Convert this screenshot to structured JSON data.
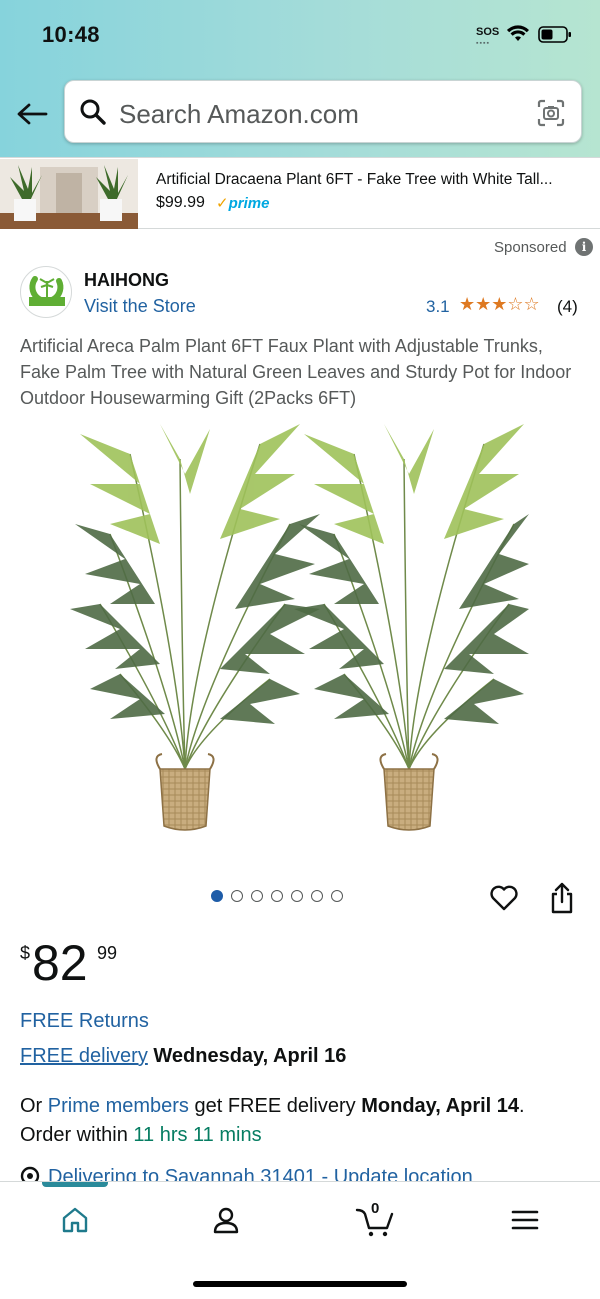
{
  "status_bar": {
    "time": "10:48",
    "sos": "SOS"
  },
  "header": {
    "search_placeholder": "Search Amazon.com",
    "back_icon": "back-arrow-icon",
    "search_icon": "search-icon",
    "camera_icon": "camera-icon"
  },
  "ad_banner": {
    "title": "Artificial Dracaena Plant 6FT - Fake Tree with White Tall...",
    "price": "$99.99",
    "prime_label": "prime"
  },
  "sponsored_label": "Sponsored",
  "brand": {
    "name": "HAIHONG",
    "visit_store": "Visit the Store",
    "logo_text": "HAIHONG"
  },
  "rating": {
    "value": "3.1",
    "stars": 3.1,
    "stars_text": "★★★☆☆",
    "count": "(4)"
  },
  "product": {
    "title": "Artificial Areca Palm Plant 6FT Faux Plant with Adjustable Trunks, Fake Palm Tree with Natural Green Leaves and Sturdy Pot for Indoor Outdoor Housewarming Gift (2Packs 6FT)",
    "image_count": 7,
    "active_image_index": 0
  },
  "price": {
    "symbol": "$",
    "whole": "82",
    "fraction": "99"
  },
  "shipping": {
    "free_returns": "FREE Returns",
    "free_delivery": "FREE delivery",
    "delivery_date": "Wednesday, April 16",
    "prime_prefix": "Or",
    "prime_members": "Prime members",
    "prime_middle": "get FREE delivery",
    "prime_date": "Monday, April 14",
    "prime_period": ".",
    "order_within_label": "Order within",
    "order_within_time": "11 hrs 11 mins",
    "deliver_to": "Delivering to Savannah 31401 - Update location"
  },
  "bottom_nav": {
    "cart_count": "0",
    "items": [
      "home-icon",
      "account-icon",
      "cart-icon",
      "menu-icon"
    ]
  },
  "colors": {
    "link": "#2162a1",
    "star": "#de7921",
    "green": "#067d62",
    "prime": "#00a8e1",
    "header_gradient_start": "#86d3dc",
    "header_gradient_end": "#b6e5d1"
  }
}
